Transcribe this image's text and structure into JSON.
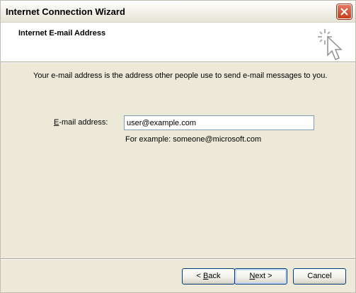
{
  "window": {
    "title": "Internet Connection Wizard"
  },
  "header": {
    "title": "Internet E-mail Address",
    "icon": "wizard-wand-icon"
  },
  "main": {
    "intro": "Your e-mail address is the address other people use to send e-mail messages to you.",
    "email_label_accel": "E",
    "email_label_rest": "-mail address:",
    "email_value": "user@example.com",
    "example": "For example: someone@microsoft.com"
  },
  "buttons": {
    "back_arrow": "< ",
    "back_accel": "B",
    "back_rest": "ack",
    "next_accel": "N",
    "next_rest": "ext",
    "next_arrow": " >",
    "cancel": "Cancel"
  },
  "colors": {
    "dialog_bg": "#ece9d8",
    "close_button": "#c4401f",
    "input_border": "#7f9db9",
    "button_border": "#003c74"
  }
}
